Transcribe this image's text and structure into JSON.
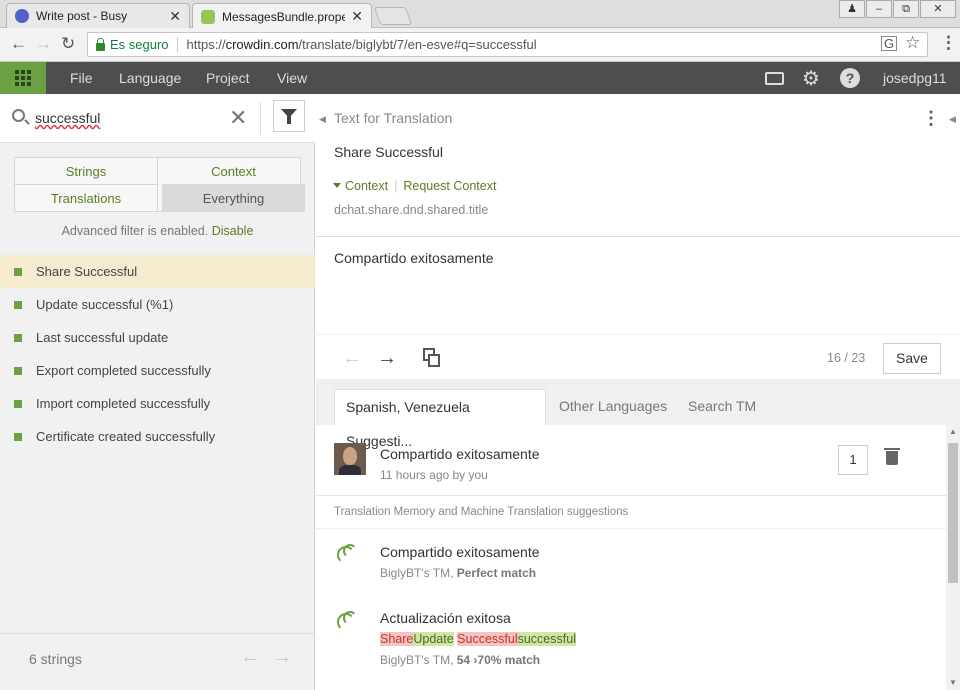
{
  "browser": {
    "tabs": [
      {
        "title": "Write post - Busy",
        "close": "✕"
      },
      {
        "title": "MessagesBundle.properti",
        "close": "✕"
      }
    ],
    "secure_label": "Es seguro",
    "url_scheme": "https://",
    "url_host": "crowdin.com",
    "url_path": "/translate/biglybt/7/en-esve#q=successful"
  },
  "menu": {
    "file": "File",
    "language": "Language",
    "project": "Project",
    "view": "View",
    "user": "josedpg11"
  },
  "search": {
    "value": "successful"
  },
  "filters": {
    "strings": "Strings",
    "context": "Context",
    "translations": "Translations",
    "everything": "Everything",
    "selected": "Everything"
  },
  "advanced": {
    "text": "Advanced filter is enabled.",
    "link": "Disable"
  },
  "string_list": [
    "Share Successful",
    "Update successful (%1)",
    "Last successful update",
    "Export completed successfully",
    "Import completed successfully",
    "Certificate created successfully"
  ],
  "footer": {
    "count": "6 strings"
  },
  "editor": {
    "section_label": "Text for Translation",
    "source_text": "Share Successful",
    "context_link": "Context",
    "request_context": "Request Context",
    "key": "dchat.share.dnd.shared.title",
    "translation": "Compartido exitosamente",
    "progress": "16 / 23",
    "save": "Save"
  },
  "suggestion_tabs": {
    "tab1": "Spanish, Venezuela Suggesti...",
    "tab2": "Other Languages",
    "tab3": "Search TM"
  },
  "suggestions": {
    "user_suggestion": "Compartido exitosamente",
    "user_meta": "11 hours ago by you",
    "votes": "1",
    "tm_label": "Translation Memory and Machine Translation suggestions",
    "tm1_text": "Compartido exitosamente",
    "tm1_source": "BiglyBT's TM, ",
    "tm1_match": "Perfect match",
    "tm2_text": "Actualización exitosa",
    "tm2_del1": "Share",
    "tm2_ins1": "Update",
    "tm2_del2": "Successful",
    "tm2_ins2": "successful",
    "tm2_source": "BiglyBT's TM, ",
    "tm2_match": "54 ›70% match"
  },
  "colors": {
    "accent_green": "#6aa142",
    "link_green": "#5a7d24",
    "header_dark": "#4e4e4e",
    "active_row": "#f5ecd0"
  }
}
